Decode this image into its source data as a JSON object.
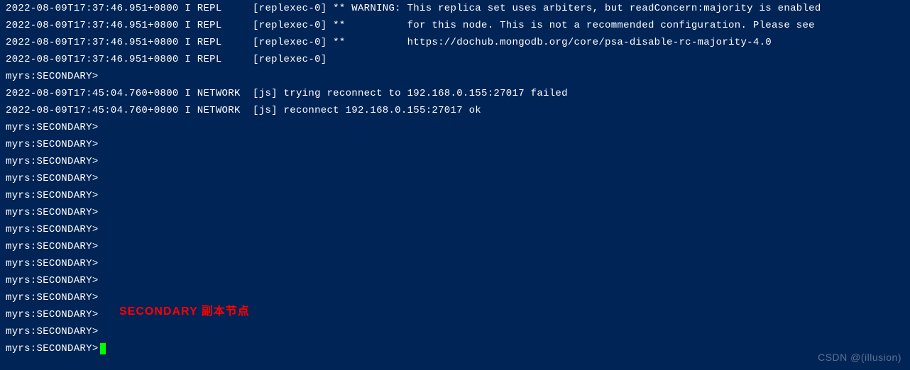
{
  "log_lines": [
    "2022-08-09T17:37:46.951+0800 I REPL     [replexec-0] ** WARNING: This replica set uses arbiters, but readConcern:majority is enabled",
    "2022-08-09T17:37:46.951+0800 I REPL     [replexec-0] **          for this node. This is not a recommended configuration. Please see",
    "2022-08-09T17:37:46.951+0800 I REPL     [replexec-0] **          https://dochub.mongodb.org/core/psa-disable-rc-majority-4.0",
    "2022-08-09T17:37:46.951+0800 I REPL     [replexec-0]"
  ],
  "prompt_text": "myrs:SECONDARY>",
  "network_lines": [
    "2022-08-09T17:45:04.760+0800 I NETWORK  [js] trying reconnect to 192.168.0.155:27017 failed",
    "2022-08-09T17:45:04.760+0800 I NETWORK  [js] reconnect 192.168.0.155:27017 ok"
  ],
  "annotation_text": "SECONDARY  副本节点",
  "watermark_text": "CSDN @(illusion)",
  "prompt_repeat_count": 14
}
